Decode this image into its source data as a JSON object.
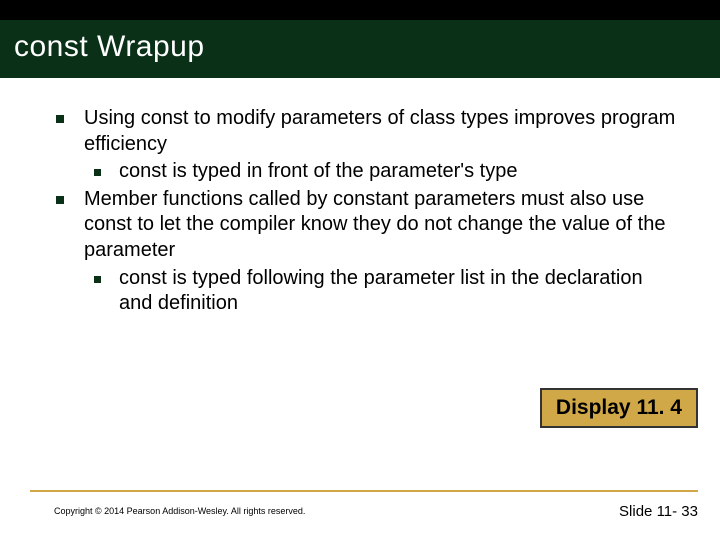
{
  "title": "const Wrapup",
  "bullets": {
    "b1": "Using const to modify parameters of class types improves program efficiency",
    "b1a": "const is typed in front of the parameter's type",
    "b2": "Member functions called by constant parameters must also use const to let the compiler know they do not change the value of the parameter",
    "b2a": "const is typed following the parameter list in the declaration and definition"
  },
  "display_button": "Display 11. 4",
  "copyright": "Copyright © 2014 Pearson Addison-Wesley.  All rights reserved.",
  "slide_number": "Slide 11- 33"
}
